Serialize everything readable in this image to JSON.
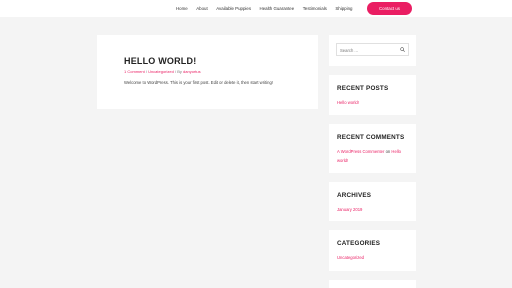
{
  "nav": {
    "items": [
      "Home",
      "About",
      "Available Puppies",
      "Health Guarantee",
      "Testimonials",
      "Shipping"
    ],
    "cta": "Contact us"
  },
  "post": {
    "title": "HELLO WORLD!",
    "comments": "1 Comment",
    "category": "Uncategorized",
    "author_prefix": "By",
    "author": "danyortus",
    "meta_separator": "/",
    "excerpt": "Welcome to WordPress. This is your first post. Edit or delete it, then start writing!"
  },
  "sidebar": {
    "search": {
      "placeholder": "Search ..."
    },
    "recent_posts": {
      "title": "RECENT POSTS",
      "items": [
        "Hello world!"
      ]
    },
    "recent_comments": {
      "title": "RECENT COMMENTS",
      "author": "A WordPress Commenter",
      "connector": "on",
      "post": "Hello world!"
    },
    "archives": {
      "title": "ARCHIVES",
      "items": [
        "January 2019"
      ]
    },
    "categories": {
      "title": "CATEGORIES",
      "items": [
        "Uncategorized"
      ]
    }
  },
  "colors": {
    "accent": "#ea1e63",
    "background": "#f4f4f4",
    "card": "#ffffff"
  },
  "icons": {
    "search": "search-icon"
  }
}
